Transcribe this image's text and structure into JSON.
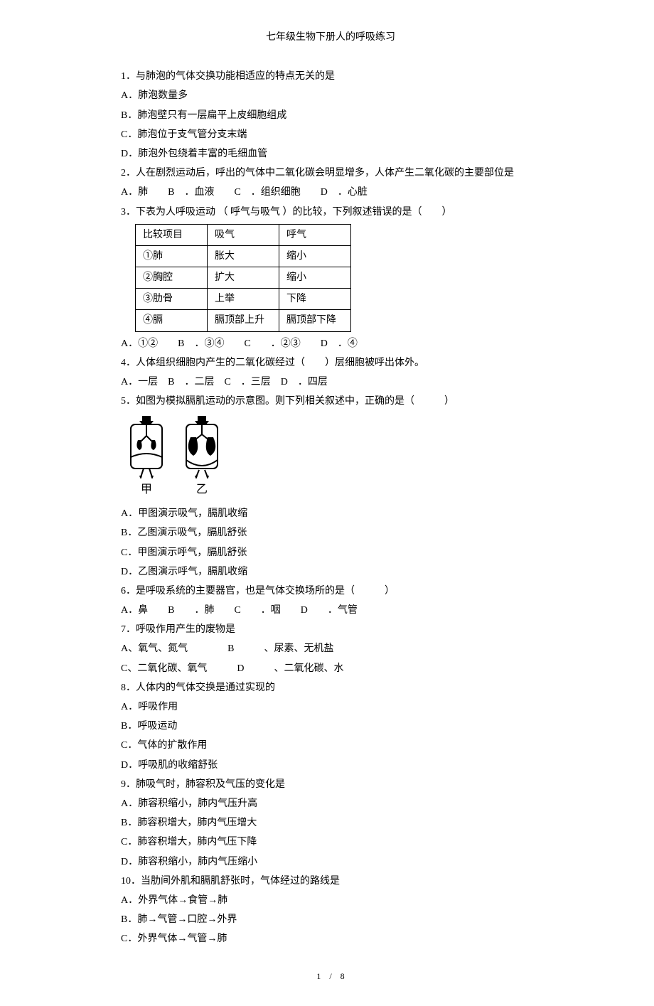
{
  "title": "七年级生物下册人的呼吸练习",
  "q1": {
    "stem": "1．与肺泡的气体交换功能相适应的特点无关的是",
    "A": "A．肺泡数量多",
    "B": "B．肺泡壁只有一层扁平上皮细胞组成",
    "C": "C．肺泡位于支气管分支末端",
    "D": "D．肺泡外包绕着丰富的毛细血管"
  },
  "q2": {
    "stem": "2．人在剧烈运动后，呼出的气体中二氧化碳会明显增多，人体产生二氧化碳的主要部位是",
    "opts": "A．肺  B ．血液  C ．组织细胞  D ．心脏"
  },
  "q3": {
    "stem": "3．下表为人呼吸运动 （ 呼气与吸气 ）的比较，下列叙述错误的是（  ）",
    "table": {
      "h1": "比较项目",
      "h2": "吸气",
      "h3": "呼气",
      "r1c1": "①肺",
      "r1c2": "胀大",
      "r1c3": "缩小",
      "r2c1": "②胸腔",
      "r2c2": "扩大",
      "r2c3": "缩小",
      "r3c1": "③肋骨",
      "r3c2": "上举",
      "r3c3": "下降",
      "r4c1": "④膈",
      "r4c2": "膈顶部上升",
      "r4c3": "膈顶部下降"
    },
    "opts": "A．①②  B ．③④  C  ．②③  D ．④"
  },
  "q4": {
    "stem": "4．人体组织细胞内产生的二氧化碳经过（  ）层细胞被呼出体外。",
    "opts": "A．一层 B ．二层 C ．三层 D ．四层"
  },
  "q5": {
    "stem": "5．如图为模拟膈肌运动的示意图。则下列相关叙述中，正确的是（   ）",
    "labelA": "甲",
    "labelB": "乙",
    "A": "A．甲图演示吸气，膈肌收缩",
    "B": "B．乙图演示吸气，膈肌舒张",
    "C": "C．甲图演示呼气，膈肌舒张",
    "D": "D．乙图演示呼气，膈肌收缩"
  },
  "q6": {
    "stem": "6．是呼吸系统的主要器官，也是气体交换场所的是（   ）",
    "opts": "A．鼻  B  ．肺  C  ．咽  D  ．气管"
  },
  "q7": {
    "stem": "7．呼吸作用产生的废物是",
    "row1": "A、氧气、氮气    B   、尿素、无机盐",
    "row2": "C、二氧化碳、氧气   D   、二氧化碳、水"
  },
  "q8": {
    "stem": "8．人体内的气体交换是通过实现的",
    "A": "A．呼吸作用",
    "B": "B．呼吸运动",
    "C": "C．气体的扩散作用",
    "D": "D．呼吸肌的收缩舒张"
  },
  "q9": {
    "stem": "9．肺吸气时，肺容积及气压的变化是",
    "A": "A．肺容积缩小，肺内气压升高",
    "B": "B．肺容积增大，肺内气压增大",
    "C": "C．肺容积增大，肺内气压下降",
    "D": "D．肺容积缩小，肺内气压缩小"
  },
  "q10": {
    "stem": "10．当肋间外肌和膈肌舒张时，气体经过的路线是",
    "A": "A．外界气体→食管→肺",
    "B": "B．肺→气管→口腔→外界",
    "C": "C．外界气体→气管→肺"
  },
  "footer": "1 / 8"
}
